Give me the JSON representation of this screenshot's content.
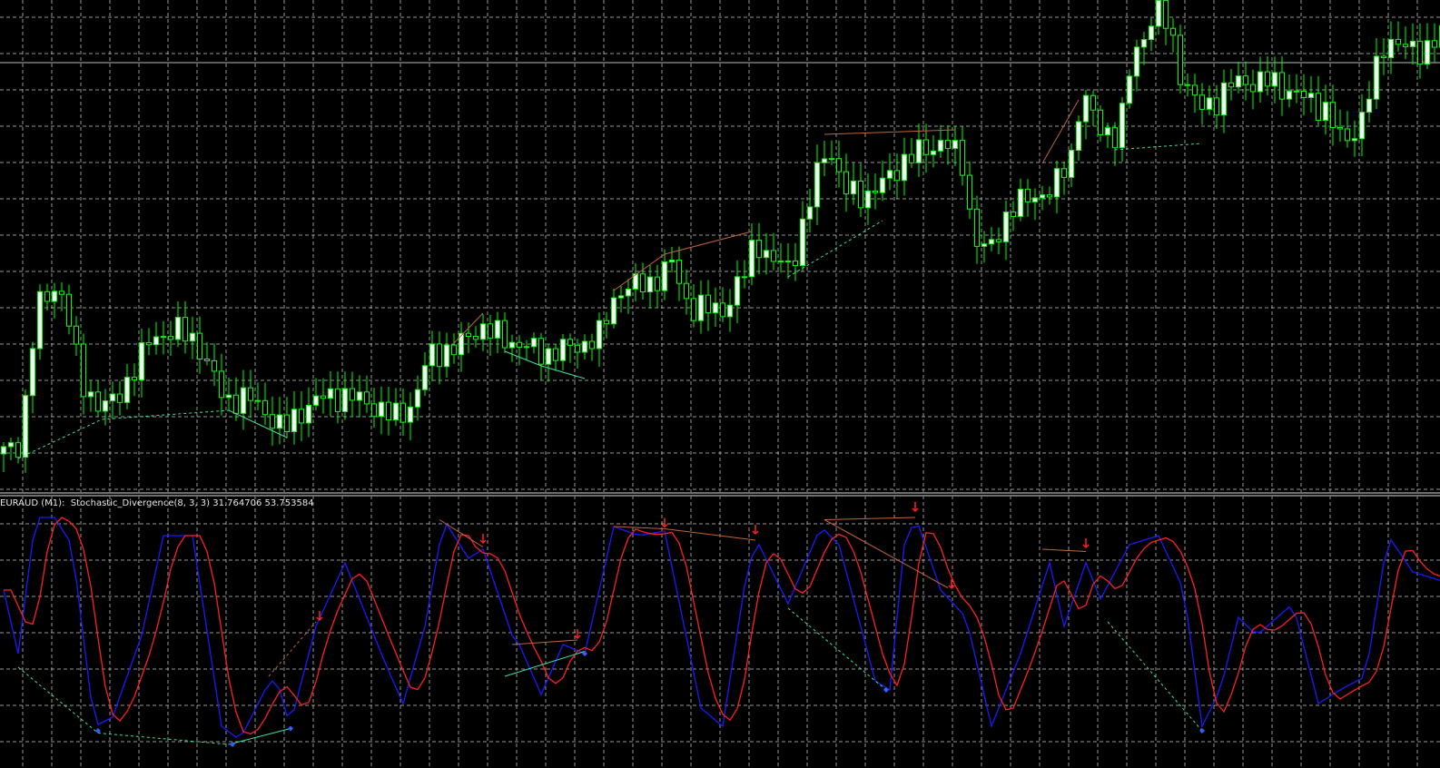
{
  "window": {
    "symbol": "EURAUD",
    "timeframe": "M1"
  },
  "indicator": {
    "label": "EURAUD (M1):  Stochastic_Divergence(8, 3, 3) 31.764706 53.753584",
    "name": "Stochastic_Divergence",
    "params": [
      8,
      3,
      3
    ],
    "main_value": 31.764706,
    "signal_value": 53.753584
  },
  "colors": {
    "background": "#000000",
    "grid": "#c8c8c8",
    "wick": "#00ff00",
    "bull": "#eaffea",
    "bear": "#000000",
    "stoch_main": "#1a1aff",
    "stoch_signal": "#ff2020",
    "bull_div": "#40e0a0",
    "bear_div": "#c0643c",
    "arrow": "#ff2020",
    "marker": "#3060ff"
  },
  "chart_data": {
    "type": "candlestick",
    "bars": 199,
    "price_path": [
      [
        0,
        10
      ],
      [
        2.5,
        12
      ],
      [
        3.75,
        24
      ],
      [
        5,
        42
      ],
      [
        6.25,
        44
      ],
      [
        8,
        48
      ],
      [
        10,
        36
      ],
      [
        11,
        26
      ],
      [
        14,
        20
      ],
      [
        16,
        22
      ],
      [
        19,
        30
      ],
      [
        21,
        36
      ],
      [
        25,
        37
      ],
      [
        27,
        35
      ],
      [
        29,
        28
      ],
      [
        31,
        22
      ],
      [
        35,
        22
      ],
      [
        39,
        15
      ],
      [
        41,
        19
      ],
      [
        45,
        23
      ],
      [
        50,
        22
      ],
      [
        54,
        18
      ],
      [
        57,
        21
      ],
      [
        59,
        32
      ],
      [
        62.5,
        33
      ],
      [
        66,
        38
      ],
      [
        70,
        35
      ],
      [
        75,
        32
      ],
      [
        80,
        34
      ],
      [
        82.5,
        36
      ],
      [
        85,
        46
      ],
      [
        90,
        48
      ],
      [
        92.5,
        52
      ],
      [
        95,
        42
      ],
      [
        100,
        42
      ],
      [
        102.5,
        50
      ],
      [
        104,
        58
      ],
      [
        106,
        52
      ],
      [
        109,
        52
      ],
      [
        111,
        62
      ],
      [
        112.5,
        72
      ],
      [
        114,
        79
      ],
      [
        116,
        68
      ],
      [
        120,
        67
      ],
      [
        124,
        74
      ],
      [
        126,
        76
      ],
      [
        130,
        79
      ],
      [
        132.5,
        74
      ],
      [
        134,
        58
      ],
      [
        136,
        54
      ],
      [
        139,
        64
      ],
      [
        142.5,
        67
      ],
      [
        145,
        68
      ],
      [
        147.5,
        76
      ],
      [
        149,
        90
      ],
      [
        151,
        82
      ],
      [
        154,
        80
      ],
      [
        156,
        98
      ],
      [
        157.5,
        102
      ],
      [
        159,
        108
      ],
      [
        161,
        104
      ],
      [
        162.5,
        94
      ],
      [
        165,
        86
      ],
      [
        167.5,
        88
      ],
      [
        170,
        92
      ],
      [
        175,
        92
      ],
      [
        180,
        88
      ],
      [
        182.5,
        86
      ],
      [
        185,
        78
      ],
      [
        187.5,
        84
      ],
      [
        189,
        92
      ],
      [
        191,
        102
      ],
      [
        195,
        98
      ],
      [
        198,
        102
      ]
    ],
    "horizontal_level": 96.2,
    "price_divergences": [
      {
        "kind": "bull",
        "style": "dashed",
        "points": [
          [
            2,
            9
          ],
          [
            13.5,
            17.6
          ],
          [
            31,
            19.6
          ]
        ]
      },
      {
        "kind": "bull",
        "style": "solid",
        "points": [
          [
            31,
            19.6
          ],
          [
            39,
            13.6
          ]
        ]
      },
      {
        "kind": "bear",
        "style": "solid",
        "points": [
          [
            62,
            34.4
          ],
          [
            66,
            41
          ]
        ]
      },
      {
        "kind": "bull",
        "style": "solid",
        "points": [
          [
            69,
            32.6
          ],
          [
            74,
            29.4
          ],
          [
            80,
            26.6
          ]
        ]
      },
      {
        "kind": "bear",
        "style": "solid",
        "points": [
          [
            84,
            46
          ],
          [
            91,
            54
          ],
          [
            103,
            59
          ]
        ]
      },
      {
        "kind": "bull",
        "style": "dashed",
        "points": [
          [
            108,
            49
          ],
          [
            121,
            61.4
          ]
        ]
      },
      {
        "kind": "bear",
        "style": "solid",
        "points": [
          [
            113,
            80.4
          ],
          [
            131,
            81.4
          ]
        ]
      },
      {
        "kind": "bear",
        "style": "solid",
        "points": [
          [
            143,
            74
          ],
          [
            148,
            88
          ]
        ]
      },
      {
        "kind": "bull",
        "style": "dashed",
        "points": [
          [
            153,
            77
          ],
          [
            165,
            78.4
          ]
        ]
      }
    ],
    "stochastic": {
      "ylim": [
        0,
        100
      ],
      "main": [
        [
          0,
          66
        ],
        [
          2,
          38
        ],
        [
          4.4,
          98
        ],
        [
          7,
          98
        ],
        [
          9.4,
          86
        ],
        [
          12.5,
          6
        ],
        [
          15,
          10
        ],
        [
          19,
          46
        ],
        [
          22,
          90
        ],
        [
          26,
          90
        ],
        [
          30,
          6
        ],
        [
          32.5,
          0
        ],
        [
          36,
          22
        ],
        [
          37.5,
          28
        ],
        [
          39.4,
          6
        ],
        [
          43,
          50
        ],
        [
          47,
          78
        ],
        [
          52.5,
          34
        ],
        [
          55,
          16
        ],
        [
          58,
          50
        ],
        [
          60.6,
          97
        ],
        [
          64,
          80
        ],
        [
          66,
          84
        ],
        [
          70,
          46
        ],
        [
          71,
          42
        ],
        [
          74,
          20
        ],
        [
          77,
          42
        ],
        [
          80,
          38
        ],
        [
          84,
          94
        ],
        [
          87.5,
          90
        ],
        [
          91,
          92
        ],
        [
          96,
          14
        ],
        [
          99,
          6
        ],
        [
          102.5,
          78
        ],
        [
          104,
          86
        ],
        [
          108,
          60
        ],
        [
          112.5,
          94
        ],
        [
          115,
          86
        ],
        [
          120,
          26
        ],
        [
          122,
          22
        ],
        [
          124,
          86
        ],
        [
          125.6,
          98
        ],
        [
          129,
          66
        ],
        [
          132.5,
          54
        ],
        [
          136,
          6
        ],
        [
          140,
          38
        ],
        [
          144,
          78
        ],
        [
          146,
          50
        ],
        [
          149,
          78
        ],
        [
          151,
          62
        ],
        [
          155,
          86
        ],
        [
          159,
          90
        ],
        [
          162.5,
          66
        ],
        [
          165,
          6
        ],
        [
          167.5,
          22
        ],
        [
          170,
          54
        ],
        [
          172.5,
          46
        ],
        [
          177.5,
          60
        ],
        [
          181,
          16
        ],
        [
          184,
          22
        ],
        [
          187.5,
          28
        ],
        [
          190.6,
          90
        ],
        [
          194,
          74
        ],
        [
          198,
          70
        ]
      ],
      "signal_period": 3,
      "divergences": [
        {
          "kind": "bull",
          "style": "dashed",
          "points": [
            [
              2,
              32
            ],
            [
              13,
              3
            ],
            [
              31,
              -2
            ]
          ]
        },
        {
          "kind": "bull",
          "style": "solid",
          "points": [
            [
              31,
              -2
            ],
            [
              39.5,
              5
            ]
          ]
        },
        {
          "kind": "bear",
          "style": "dashed",
          "points": [
            [
              36.5,
              28
            ],
            [
              43,
              52
            ]
          ]
        },
        {
          "kind": "bear",
          "style": "solid",
          "points": [
            [
              60,
              97
            ],
            [
              66,
              85
            ]
          ]
        },
        {
          "kind": "bull",
          "style": "solid",
          "points": [
            [
              69,
              28
            ],
            [
              80,
              39
            ]
          ]
        },
        {
          "kind": "bear",
          "style": "solid",
          "points": [
            [
              70,
              42
            ],
            [
              79,
              44
            ]
          ]
        },
        {
          "kind": "bear",
          "style": "solid",
          "points": [
            [
              84,
              94
            ],
            [
              91,
              93
            ],
            [
              103.5,
              88
            ]
          ]
        },
        {
          "kind": "bull",
          "style": "dashed",
          "points": [
            [
              108,
              58
            ],
            [
              121.5,
              22
            ]
          ]
        },
        {
          "kind": "bear",
          "style": "solid",
          "points": [
            [
              113,
              97
            ],
            [
              125.5,
              98
            ]
          ]
        },
        {
          "kind": "bear",
          "style": "solid",
          "points": [
            [
              113,
              97
            ],
            [
              130,
              67
            ]
          ]
        },
        {
          "kind": "bear",
          "style": "solid",
          "points": [
            [
              143,
              84
            ],
            [
              149,
              83
            ]
          ]
        },
        {
          "kind": "bull",
          "style": "dashed",
          "points": [
            [
              152,
              52
            ],
            [
              165,
              4
            ]
          ]
        }
      ],
      "sell_arrows": [
        [
          43.5,
          52
        ],
        [
          66,
          86
        ],
        [
          79,
          44
        ],
        [
          91,
          93
        ],
        [
          103.5,
          90
        ],
        [
          125.5,
          100
        ],
        [
          130.5,
          66
        ],
        [
          149,
          84
        ]
      ],
      "buy_markers": [
        [
          13,
          4
        ],
        [
          31.5,
          -2
        ],
        [
          39.5,
          5
        ],
        [
          80,
          38
        ],
        [
          121.5,
          22
        ],
        [
          165,
          4
        ]
      ]
    }
  }
}
